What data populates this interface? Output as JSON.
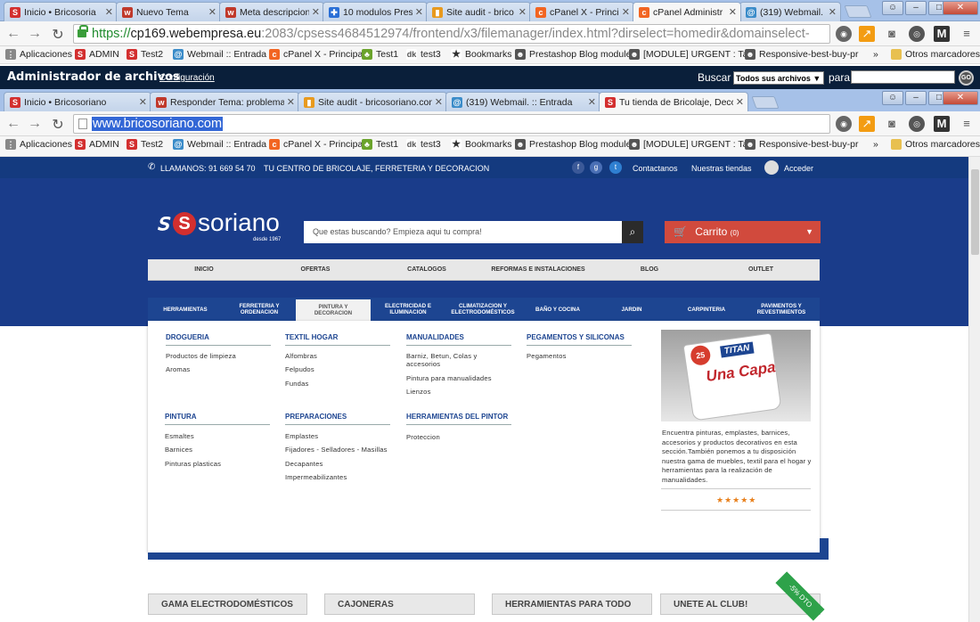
{
  "outer_tabs": [
    {
      "title": "Inicio • Bricosoria",
      "icon": "soriano-icon",
      "color": "#d32f2f"
    },
    {
      "title": "Nuevo Tema",
      "icon": "webempresa-icon",
      "color": "#c0392b"
    },
    {
      "title": "Meta descripcion",
      "icon": "webempresa-icon",
      "color": "#c0392b"
    },
    {
      "title": "10 modulos Prest",
      "icon": "puzzle-icon",
      "color": "#2a6fd6"
    },
    {
      "title": "Site audit - brico",
      "icon": "chart-icon",
      "color": "#e89a1e"
    },
    {
      "title": "cPanel X - Princip",
      "icon": "cpanel-icon",
      "color": "#f26522"
    },
    {
      "title": "cPanel Administr",
      "icon": "cpanel-icon",
      "color": "#f26522"
    },
    {
      "title": "(319) Webmail. :",
      "icon": "webmail-icon",
      "color": "#3b8cc9"
    }
  ],
  "outer_url": {
    "scheme": "https://",
    "host": "cp169.webempresa.eu",
    "rest": ":2083/cpsess4684512974/frontend/x3/filemanager/index.html?dirselect=homedir&domainselect-"
  },
  "bookmarks": [
    {
      "label": "Aplicaciones",
      "icon": "apps-icon"
    },
    {
      "label": "ADMIN",
      "icon": "soriano-icon"
    },
    {
      "label": "Test2",
      "icon": "soriano-icon"
    },
    {
      "label": "Webmail :: Entrada",
      "icon": "webmail-icon"
    },
    {
      "label": "cPanel X - Principal",
      "icon": "cpanel-icon"
    },
    {
      "label": "Test1",
      "icon": "leaf-icon"
    },
    {
      "label": "test3",
      "icon": "dk-icon"
    },
    {
      "label": "Bookmarks",
      "icon": "star-icon"
    },
    {
      "label": "Prestashop Blog module",
      "icon": "prestashop-icon"
    },
    {
      "label": "[MODULE] URGENT : Ta",
      "icon": "prestashop-icon"
    },
    {
      "label": "Responsive-best-buy-pr",
      "icon": "prestashop-icon"
    },
    {
      "label": "»",
      "icon": ""
    },
    {
      "label": "Otros marcadores",
      "icon": "folder-icon"
    }
  ],
  "cpanel": {
    "title": "Administrador de archivos",
    "config": "Configuración",
    "buscar": "Buscar",
    "select_value": "Todos sus archivos ▼",
    "para": "para",
    "go": "GO"
  },
  "inner_tabs": [
    {
      "title": "Inicio • Bricosoriano",
      "icon": "soriano-icon",
      "color": "#d32f2f"
    },
    {
      "title": "Responder Tema: problema c",
      "icon": "webempresa-icon",
      "color": "#c0392b"
    },
    {
      "title": "Site audit - bricosoriano.com",
      "icon": "chart-icon",
      "color": "#e89a1e"
    },
    {
      "title": "(319) Webmail. :: Entrada",
      "icon": "webmail-icon",
      "color": "#3b8cc9"
    },
    {
      "title": "Tu tienda de Bricolaje, Decor",
      "icon": "soriano-icon",
      "color": "#d32f2f"
    }
  ],
  "inner_url": "www.bricosoriano.com",
  "site": {
    "phone": "LLAMANOS: 91 669 54 70",
    "tagline": "TU CENTRO DE BRICOLAJE, FERRETERIA Y DECORACION",
    "top_links": [
      "Contactanos",
      "Nuestras tiendas",
      "Acceder"
    ],
    "logo": "soriano",
    "logo_sub": "desde 1967",
    "search_placeholder": "Que estas buscando? Empieza aqui tu compra!",
    "cart_label": "Carrito",
    "cart_count": "(0)",
    "main_nav": [
      "INICIO",
      "OFERTAS",
      "CATALOGOS",
      "REFORMAS E INSTALACIONES",
      "BLOG",
      "OUTLET"
    ],
    "categories": [
      "HERRAMIENTAS",
      "FERRETERIA Y\nORDENACION",
      "PINTURA Y\nDECORACION",
      "ELECTRICIDAD E\nILUMINACION",
      "CLIMATIZACION Y\nELECTRODOMÉSTICOS",
      "BAÑO Y COCINA",
      "JARDIN",
      "CARPINTERIA",
      "PAVIMENTOS Y\nREVESTIMIENTOS"
    ],
    "mega": {
      "groups": [
        {
          "title": "DROGUERIA",
          "items": [
            "Productos de limpieza",
            "Aromas"
          ]
        },
        {
          "title": "TEXTIL HOGAR",
          "items": [
            "Alfombras",
            "Felpudos",
            "Fundas"
          ]
        },
        {
          "title": "MANUALIDADES",
          "items": [
            "Barniz, Betun, Colas y\naccesorios",
            "Pintura para manualidades",
            "Lienzos"
          ]
        },
        {
          "title": "PEGAMENTOS Y SILICONAS",
          "items": [
            "Pegamentos"
          ]
        },
        {
          "title": "PINTURA",
          "items": [
            "Esmaltes",
            "Barnices",
            "Pinturas plasticas"
          ]
        },
        {
          "title": "PREPARACIONES",
          "items": [
            "Emplastes",
            "Fijadores - Selladores - Masillas",
            "Decapantes",
            "Impermeabilizantes"
          ]
        },
        {
          "title": "HERRAMIENTAS DEL PINTOR",
          "items": [
            "Proteccion"
          ]
        }
      ],
      "promo_brand": "TITAN",
      "promo_product": "Una Capa",
      "promo_badge": "25",
      "description": "Encuentra pinturas, emplastes, barnices, accesorios y productos decorativos en esta sección.También ponemos a tu disposición nuestra gama de muebles, textil para el hogar y herramientas para la realización de manualidades.",
      "rating_stars": "★★★★★"
    },
    "bottom_tabs": [
      "GAMA ELECTRODOMÉSTICOS",
      "CAJONERAS",
      "HERRAMIENTAS PARA TODO",
      "UNETE AL CLUB!"
    ],
    "ribbon": "-5% DTO"
  }
}
